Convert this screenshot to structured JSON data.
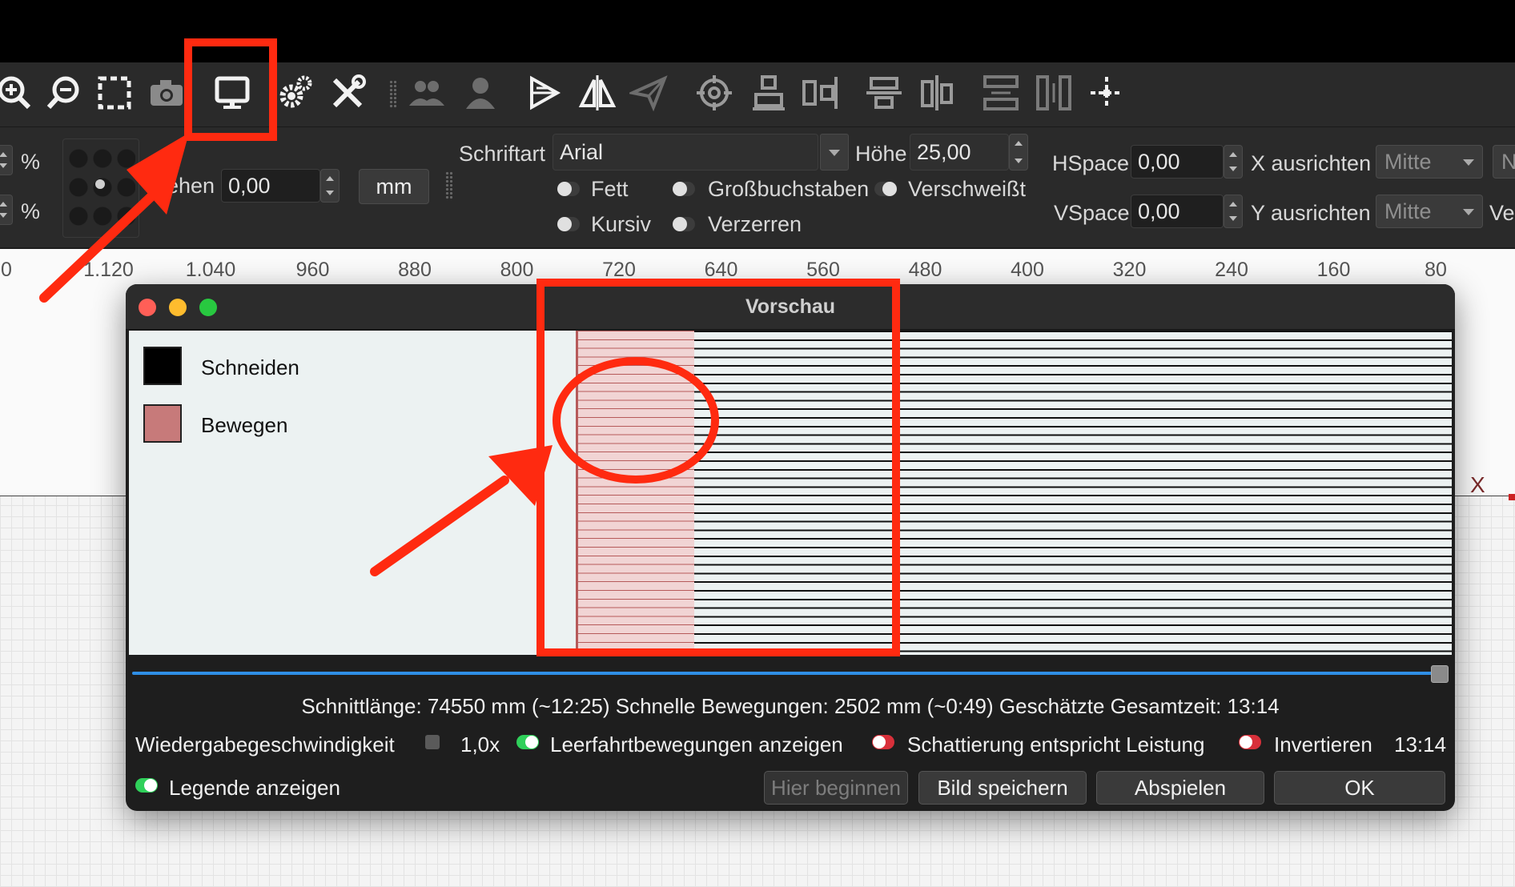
{
  "toolbar": {
    "icons": [
      "zoom-in-icon",
      "zoom-out-icon",
      "frame-selection-icon",
      "camera-icon",
      "preview-monitor-icon",
      "settings-gears-icon",
      "tools-icon",
      "users-icon",
      "user-icon",
      "mirror-horizontal-icon",
      "mirror-vertical-icon",
      "send-icon",
      "target-icon",
      "align-top-icon",
      "align-left-icon",
      "distribute-horizontal-icon",
      "distribute-vertical-icon",
      "spacing-horizontal-icon",
      "spacing-vertical-icon",
      "move-origin-icon"
    ]
  },
  "props": {
    "percent_1": "%",
    "percent_2": "%",
    "rotate_label": "ehen",
    "rotate_value": "0,00",
    "unit_button": "mm",
    "font_label": "Schriftart",
    "font_value": "Arial",
    "height_label": "Höhe",
    "height_value": "25,00",
    "bold_label": "Fett",
    "italic_label": "Kursiv",
    "caps_label": "Großbuchstaben",
    "distort_label": "Verzerren",
    "welded_label": "Verschweißt",
    "hspace_label": "HSpace",
    "hspace_value": "0,00",
    "vspace_label": "VSpace",
    "vspace_value": "0,00",
    "x_align_label": "X ausrichten",
    "x_align_value": "Mitte",
    "y_align_label": "Y ausrichten",
    "y_align_value": "Mitte",
    "cut_off_1": "Ne",
    "cut_off_2": "Ve"
  },
  "ruler": {
    "ticks": [
      "0",
      "1.120",
      "1.040",
      "960",
      "880",
      "800",
      "720",
      "640",
      "560",
      "480",
      "400",
      "320",
      "240",
      "160",
      "80"
    ]
  },
  "canvas": {
    "axis_label": "X"
  },
  "dialog": {
    "title": "Vorschau",
    "legend": [
      {
        "label": "Schneiden",
        "color": "#000000"
      },
      {
        "label": "Bewegen",
        "color": "#c77a7a"
      }
    ],
    "stats": "Schnittlänge: 74550 mm (~12:25) Schnelle Bewegungen: 2502 mm (~0:49) Geschätzte Gesamtzeit: 13:14",
    "playback_label": "Wiedergabegeschwindigkeit",
    "speed": "1,0x",
    "show_traversal": "Leerfahrtbewegungen anzeigen",
    "shading_power": "Schattierung entspricht Leistung",
    "invert": "Invertieren",
    "time": "13:14",
    "show_legend": "Legende anzeigen",
    "btn_start_here": "Hier beginnen",
    "btn_save_image": "Bild speichern",
    "btn_play": "Abspielen",
    "btn_ok": "OK"
  },
  "colors": {
    "annotation": "#ff2a10",
    "progress": "#2f8fe6",
    "toggle_on": "#2fd05a",
    "toggle_off": "#d8303a"
  }
}
